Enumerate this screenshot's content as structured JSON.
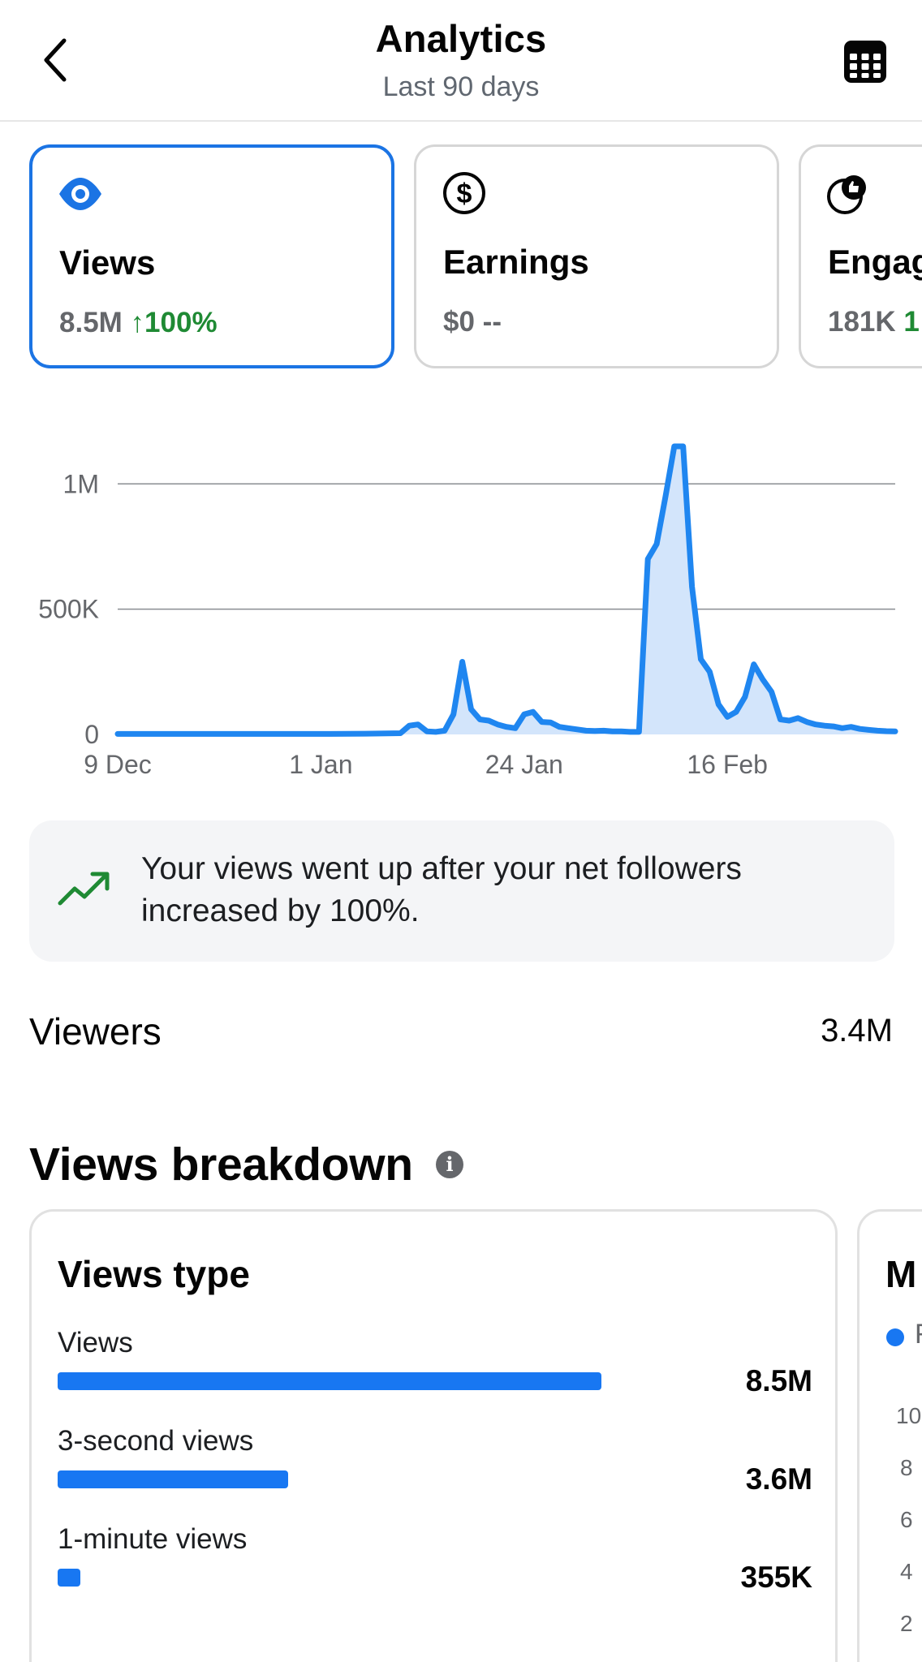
{
  "header": {
    "title": "Analytics",
    "subtitle": "Last 90 days"
  },
  "metric_cards": [
    {
      "label": "Views",
      "value": "8.5M",
      "delta": "↑100%",
      "icon": "eye-icon",
      "selected": true
    },
    {
      "label": "Earnings",
      "value": "$0",
      "delta": "--",
      "icon": "dollar-icon",
      "selected": false
    },
    {
      "label": "Engag",
      "value": "181K",
      "delta": "1",
      "icon": "engagement-icon",
      "selected": false
    }
  ],
  "colors": {
    "accent": "#1b74e4",
    "positive": "#1f8a34",
    "chart_line": "#1f86f0",
    "chart_fill": "#d3e5fb"
  },
  "chart_data": {
    "type": "area",
    "title": "",
    "xlabel": "",
    "ylabel": "",
    "x_ticks": [
      "9 Dec",
      "1 Jan",
      "24 Jan",
      "16 Feb"
    ],
    "y_ticks": [
      "0",
      "500K",
      "1M"
    ],
    "ylim": [
      0,
      1150000
    ],
    "grid": true,
    "series": [
      {
        "name": "",
        "x": [
          "2023-12-09",
          "2023-12-13",
          "2023-12-17",
          "2023-12-21",
          "2023-12-25",
          "2023-12-29",
          "2024-01-02",
          "2024-01-06",
          "2024-01-10",
          "2024-01-11",
          "2024-01-12",
          "2024-01-13",
          "2024-01-14",
          "2024-01-15",
          "2024-01-16",
          "2024-01-17",
          "2024-01-18",
          "2024-01-19",
          "2024-01-20",
          "2024-01-21",
          "2024-01-22",
          "2024-01-23",
          "2024-01-24",
          "2024-01-25",
          "2024-01-26",
          "2024-01-27",
          "2024-01-28",
          "2024-01-29",
          "2024-01-30",
          "2024-01-31",
          "2024-02-01",
          "2024-02-02",
          "2024-02-03",
          "2024-02-04",
          "2024-02-05",
          "2024-02-06",
          "2024-02-07",
          "2024-02-08",
          "2024-02-09",
          "2024-02-10",
          "2024-02-11",
          "2024-02-12",
          "2024-02-13",
          "2024-02-14",
          "2024-02-15",
          "2024-02-16",
          "2024-02-17",
          "2024-02-18",
          "2024-02-19",
          "2024-02-20",
          "2024-02-21",
          "2024-02-22",
          "2024-02-23",
          "2024-02-24",
          "2024-02-25",
          "2024-02-26",
          "2024-02-27",
          "2024-02-28",
          "2024-02-29",
          "2024-03-01",
          "2024-03-02",
          "2024-03-03",
          "2024-03-04",
          "2024-03-05",
          "2024-03-06"
        ],
        "y": [
          2000,
          2000,
          2000,
          2000,
          2000,
          2000,
          2000,
          3000,
          5000,
          35000,
          40000,
          12000,
          10000,
          15000,
          80000,
          290000,
          100000,
          60000,
          55000,
          40000,
          30000,
          25000,
          80000,
          90000,
          50000,
          48000,
          30000,
          25000,
          20000,
          15000,
          14000,
          15000,
          12000,
          12000,
          10000,
          10000,
          700000,
          760000,
          950000,
          1150000,
          1150000,
          590000,
          300000,
          250000,
          120000,
          70000,
          90000,
          150000,
          280000,
          220000,
          170000,
          60000,
          55000,
          65000,
          50000,
          40000,
          35000,
          32000,
          25000,
          30000,
          22000,
          18000,
          15000,
          13000,
          12000
        ]
      }
    ]
  },
  "insight": {
    "icon": "trending-up-icon",
    "text": "Your views went up after your net followers increased by 100%."
  },
  "viewers": {
    "label": "Viewers",
    "value": "3.4M"
  },
  "breakdown": {
    "title": "Views breakdown",
    "info_icon": "info-icon",
    "views_type": {
      "title": "Views type",
      "rows": [
        {
          "label": "Views",
          "value": "8.5M",
          "fraction": 1.0
        },
        {
          "label": "3-second views",
          "value": "3.6M",
          "fraction": 0.424
        },
        {
          "label": "1-minute views",
          "value": "355K",
          "fraction": 0.042
        }
      ]
    },
    "second_card": {
      "title": "M",
      "legend": "F",
      "ticks": [
        "10",
        "8",
        "6",
        "4",
        "2"
      ]
    }
  }
}
